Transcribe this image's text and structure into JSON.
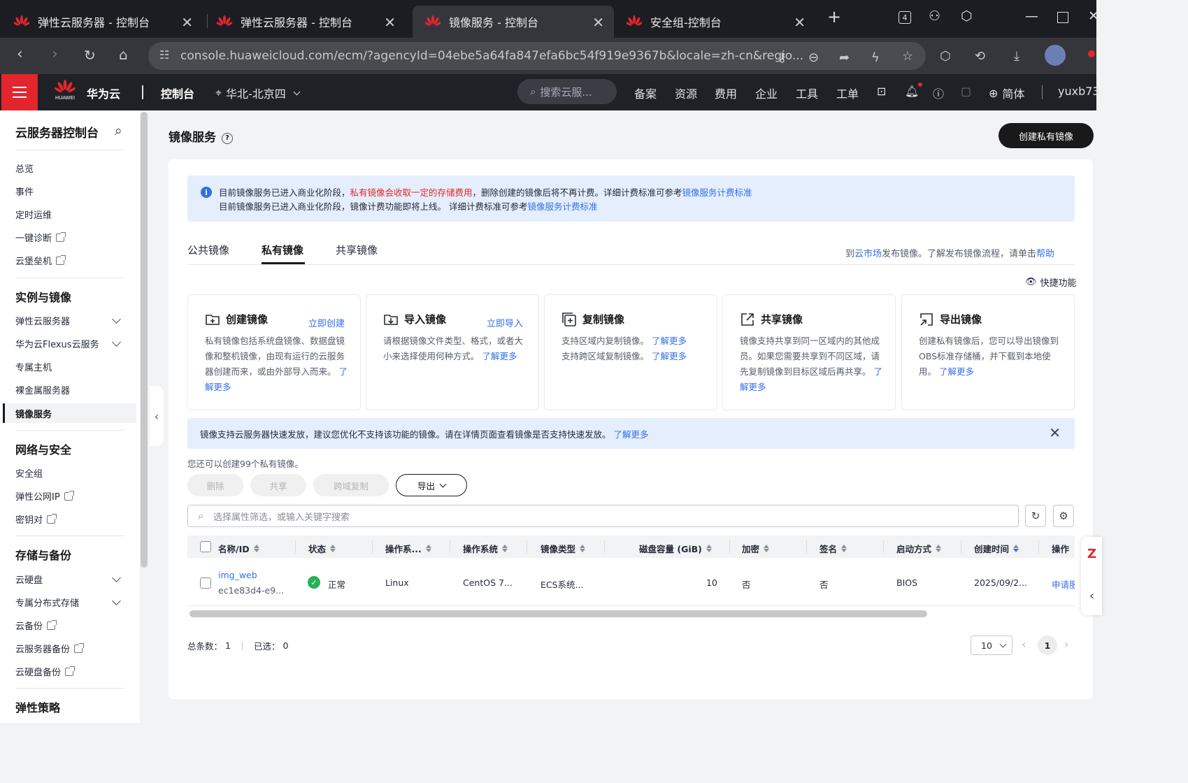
{
  "browser": {
    "tabs": [
      {
        "title": "弹性云服务器 - 控制台",
        "active": false
      },
      {
        "title": "弹性云服务器 - 控制台",
        "active": false
      },
      {
        "title": "镜像服务 - 控制台",
        "active": true
      },
      {
        "title": "安全组-控制台",
        "active": false
      }
    ],
    "tab_count_badge": "4",
    "url": "console.huaweicloud.com/ecm/?agencyId=04ebe5a64fa847efa6bc54f919e9367b&locale=zh-cn&regio..."
  },
  "header": {
    "brand": "华为云",
    "brand_small": "HUAWEI",
    "console": "控制台",
    "region": "华北-北京四",
    "search_placeholder": "搜索云服...",
    "nav": [
      "备案",
      "资源",
      "费用",
      "企业",
      "工具",
      "工单"
    ],
    "language": "简体",
    "user": "yuxb73"
  },
  "sidebar": {
    "title": "云服务器控制台",
    "items_top": [
      {
        "label": "总览"
      },
      {
        "label": "事件"
      },
      {
        "label": "定时运维"
      },
      {
        "label": "一键诊断",
        "external": true
      },
      {
        "label": "云堡垒机",
        "external": true
      }
    ],
    "group1": {
      "title": "实例与镜像",
      "items": [
        {
          "label": "弹性云服务器"
        },
        {
          "label": "华为云Flexus云服务"
        },
        {
          "label": "专属主机"
        },
        {
          "label": "裸金属服务器"
        },
        {
          "label": "镜像服务"
        }
      ]
    },
    "group2": {
      "title": "网络与安全",
      "items": [
        {
          "label": "安全组"
        },
        {
          "label": "弹性公网IP"
        },
        {
          "label": "密钥对"
        }
      ]
    },
    "group3": {
      "title": "存储与备份",
      "items": [
        {
          "label": "云硬盘"
        },
        {
          "label": "专属分布式存储"
        },
        {
          "label": "云备份"
        },
        {
          "label": "云服务器备份"
        },
        {
          "label": "云硬盘备份"
        }
      ]
    },
    "group4": {
      "title": "弹性策略"
    }
  },
  "page": {
    "title": "镜像服务",
    "create_button": "创建私有镜像",
    "notice": {
      "line1_a": "目前镜像服务已进入商业化阶段，",
      "line1_red": "私有镜像会收取一定的存储费用",
      "line1_b": "，删除创建的镜像后将不再计费。详细计费标准可参考",
      "line1_link": "镜像服务计费标准",
      "line2_a": "目前镜像服务已进入商业化阶段，镜像计费功能即将上线。 详细计费标准可参考",
      "line2_link": "镜像服务计费标准"
    },
    "tabs": [
      "公共镜像",
      "私有镜像",
      "共享镜像"
    ],
    "active_tab": "私有镜像",
    "market": {
      "a": "到",
      "link": "云市场",
      "b": "发布镜像。了解发布镜像流程，请单击",
      "help": "帮助"
    },
    "quick_label": "快捷功能",
    "feature_cards": [
      {
        "title": "创建镜像",
        "action": "立即创建",
        "desc": "私有镜像包括系统盘镜像、数据盘镜像和整机镜像，由现有运行的云服务器创建而来，或由外部导入而来。",
        "link": "了解更多"
      },
      {
        "title": "导入镜像",
        "action": "立即导入",
        "desc": "请根据镜像文件类型、格式，或者大小来选择使用何种方式。",
        "link": "了解更多"
      },
      {
        "title": "复制镜像",
        "action": "",
        "desc1": "支持区域内复制镜像。",
        "link1": "了解更多",
        "desc2": "支持跨区域复制镜像。",
        "link2": "了解更多"
      },
      {
        "title": "共享镜像",
        "action": "",
        "desc": "镜像支持共享到同一区域内的其他成员。如果您需要共享到不同区域，请先复制镜像到目标区域后再共享。",
        "link": "了解更多"
      },
      {
        "title": "导出镜像",
        "action": "",
        "desc": "创建私有镜像后，您可以导出镜像到OBS标准存储桶，并下载到本地使用。",
        "link": "了解更多"
      }
    ],
    "fast_notice": "镜像支持云服务器快速发放，建议您优化不支持该功能的镜像。请在详情页面查看镜像是否支持快速发放。",
    "fast_notice_link": "了解更多",
    "remaining": "您还可以创建99个私有镜像。",
    "actions": {
      "delete": "删除",
      "share": "共享",
      "cross_copy": "跨域复制",
      "export": "导出"
    },
    "search_placeholder": "选择属性筛选，或输入关键字搜索",
    "table": {
      "columns": [
        "名称/ID",
        "状态",
        "操作系...",
        "操作系统",
        "镜像类型",
        "磁盘容量 (GiB)",
        "加密",
        "签名",
        "启动方式",
        "创建时间",
        "操作"
      ],
      "rows": [
        {
          "name": "img_web",
          "id": "ec1e83d4-e9...",
          "status": "正常",
          "os_type": "Linux",
          "os": "CentOS 7...",
          "image_type": "ECS系统...",
          "disk": "10",
          "encrypted": "否",
          "signed": "否",
          "boot": "BIOS",
          "created": "2025/09/2...",
          "op": "申请服"
        }
      ]
    },
    "footer": {
      "total_label": "总条数：",
      "total": "1",
      "selected_label": "已选：",
      "selected": "0"
    },
    "pagination": {
      "page_size": "10",
      "current": "1"
    }
  }
}
